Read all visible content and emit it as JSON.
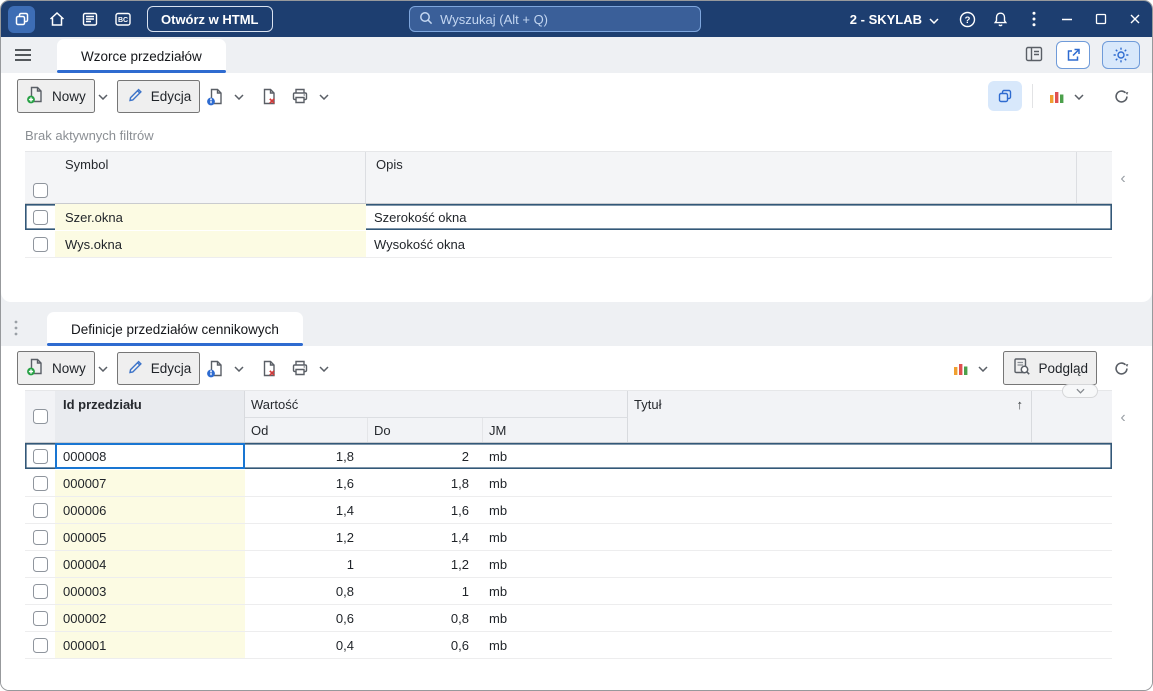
{
  "colors": {
    "topbar_bg": "#1d3e70",
    "accent": "#2e6bd0",
    "selection_border": "#335878",
    "focus_cell_border": "#1976d2",
    "key_cell_bg": "#fcfbe3"
  },
  "topbar": {
    "open_html_button": "Otwórz w HTML",
    "bc_label": "BC",
    "search_placeholder": "Wyszukaj (Alt + Q)",
    "company_selector": "2 - SKYLAB"
  },
  "icons": {
    "sort_asc": "↑",
    "collapse_left": "‹"
  },
  "panel1": {
    "tab": "Wzorce przedziałów",
    "toolbar": {
      "new": "Nowy",
      "edit": "Edycja"
    },
    "filter_status": "Brak aktywnych filtrów",
    "table": {
      "columns": {
        "symbol": "Symbol",
        "opis": "Opis"
      },
      "rows": [
        {
          "symbol": "Szer.okna",
          "opis": "Szerokość okna"
        },
        {
          "symbol": "Wys.okna",
          "opis": "Wysokość okna"
        }
      ]
    }
  },
  "panel2": {
    "tab": "Definicje przedziałów cennikowych",
    "toolbar": {
      "new": "Nowy",
      "edit": "Edycja",
      "preview": "Podgląd"
    },
    "table": {
      "columns": {
        "id": "Id przedziału",
        "value_band": "Wartość",
        "od": "Od",
        "do": "Do",
        "jm": "JM",
        "title": "Tytuł"
      },
      "rows": [
        {
          "id": "000008",
          "od": "1,8",
          "do": "2",
          "jm": "mb"
        },
        {
          "id": "000007",
          "od": "1,6",
          "do": "1,8",
          "jm": "mb"
        },
        {
          "id": "000006",
          "od": "1,4",
          "do": "1,6",
          "jm": "mb"
        },
        {
          "id": "000005",
          "od": "1,2",
          "do": "1,4",
          "jm": "mb"
        },
        {
          "id": "000004",
          "od": "1",
          "do": "1,2",
          "jm": "mb"
        },
        {
          "id": "000003",
          "od": "0,8",
          "do": "1",
          "jm": "mb"
        },
        {
          "id": "000002",
          "od": "0,6",
          "do": "0,8",
          "jm": "mb"
        },
        {
          "id": "000001",
          "od": "0,4",
          "do": "0,6",
          "jm": "mb"
        }
      ]
    }
  }
}
